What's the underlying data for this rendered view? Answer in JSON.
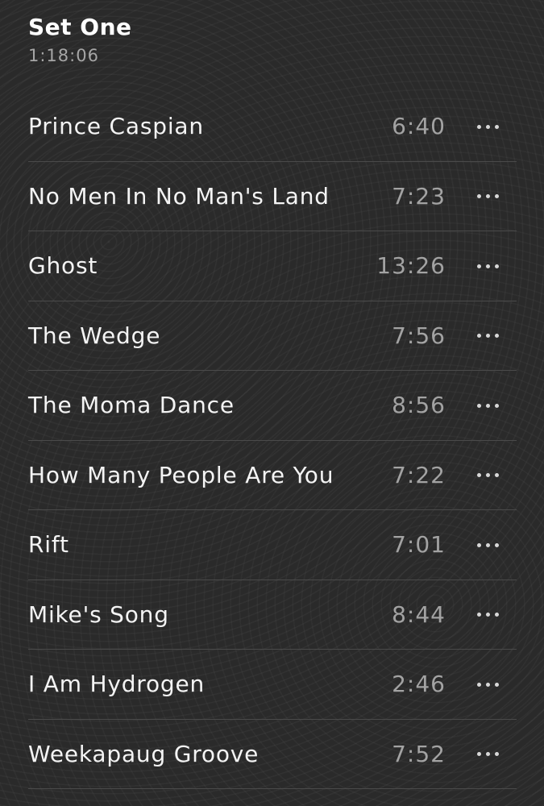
{
  "set": {
    "title": "Set One",
    "duration": "1:18:06"
  },
  "tracks": [
    {
      "title": "Prince Caspian",
      "duration": "6:40"
    },
    {
      "title": "No Men In No Man's Land",
      "duration": "7:23"
    },
    {
      "title": "Ghost",
      "duration": "13:26"
    },
    {
      "title": "The Wedge",
      "duration": "7:56"
    },
    {
      "title": "The Moma Dance",
      "duration": "8:56"
    },
    {
      "title": "How Many People Are You",
      "duration": "7:22"
    },
    {
      "title": "Rift",
      "duration": "7:01"
    },
    {
      "title": "Mike's Song",
      "duration": "8:44"
    },
    {
      "title": "I Am Hydrogen",
      "duration": "2:46"
    },
    {
      "title": "Weekapaug Groove",
      "duration": "7:52"
    }
  ],
  "icons": {
    "more": "more-horizontal-icon"
  }
}
